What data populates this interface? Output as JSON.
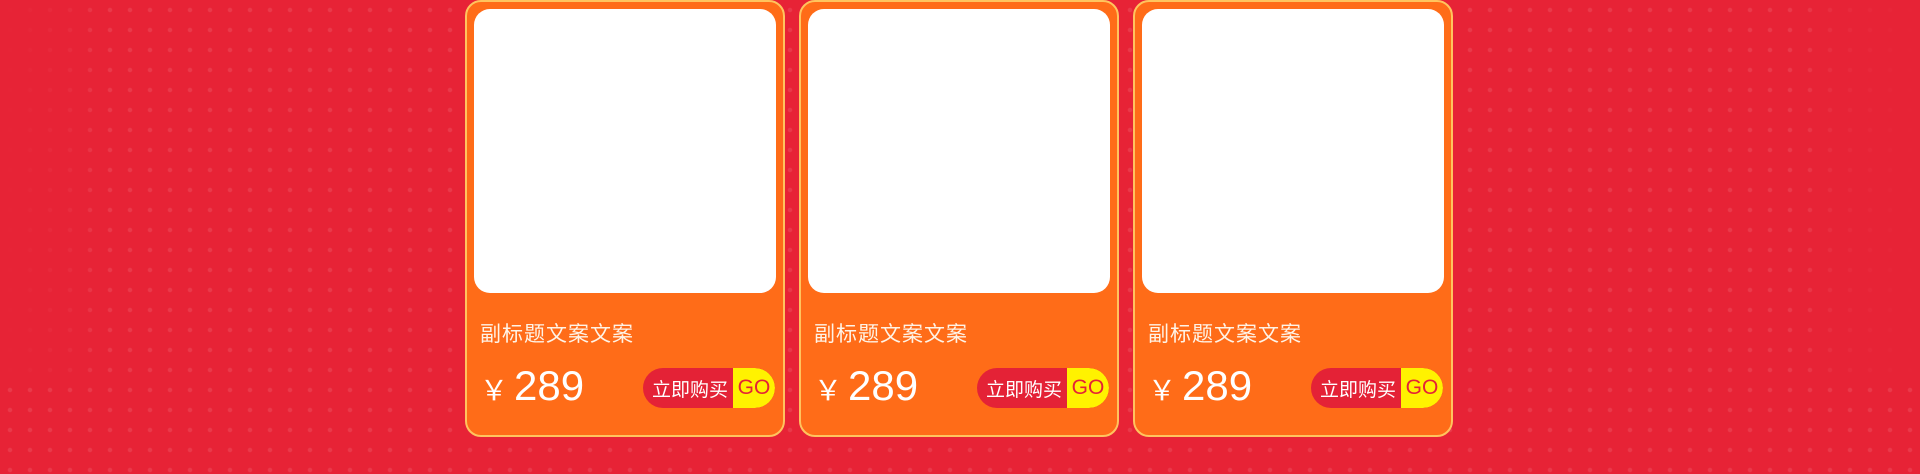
{
  "colors": {
    "background": "#e72336",
    "card": "#ff6c18",
    "card_border": "#ffc45e",
    "button": "#e42236",
    "go_badge": "#fff200"
  },
  "products": [
    {
      "subtitle": "副标题文案文案",
      "currency": "￥",
      "price": "289",
      "buy_label": "立即购买",
      "go_label": "GO"
    },
    {
      "subtitle": "副标题文案文案",
      "currency": "￥",
      "price": "289",
      "buy_label": "立即购买",
      "go_label": "GO"
    },
    {
      "subtitle": "副标题文案文案",
      "currency": "￥",
      "price": "289",
      "buy_label": "立即购买",
      "go_label": "GO"
    }
  ]
}
